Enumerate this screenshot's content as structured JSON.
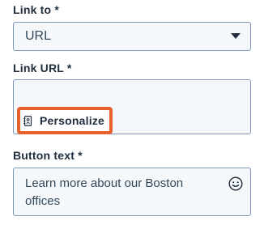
{
  "link_to": {
    "label": "Link to *",
    "selected": "URL"
  },
  "link_url": {
    "label": "Link URL *",
    "value": "",
    "personalize_label": "Personalize"
  },
  "button_text": {
    "label": "Button text *",
    "value": "Learn more about our Boston offices"
  },
  "icons": {
    "dropdown": "caret-down-icon",
    "personalize": "contact-card-icon",
    "emoji": "smiley-icon"
  },
  "colors": {
    "highlight": "#e8602c",
    "border": "#7c98b6",
    "field_bg": "#f5f8fa",
    "text": "#33475b",
    "label": "#1f2d3d"
  }
}
